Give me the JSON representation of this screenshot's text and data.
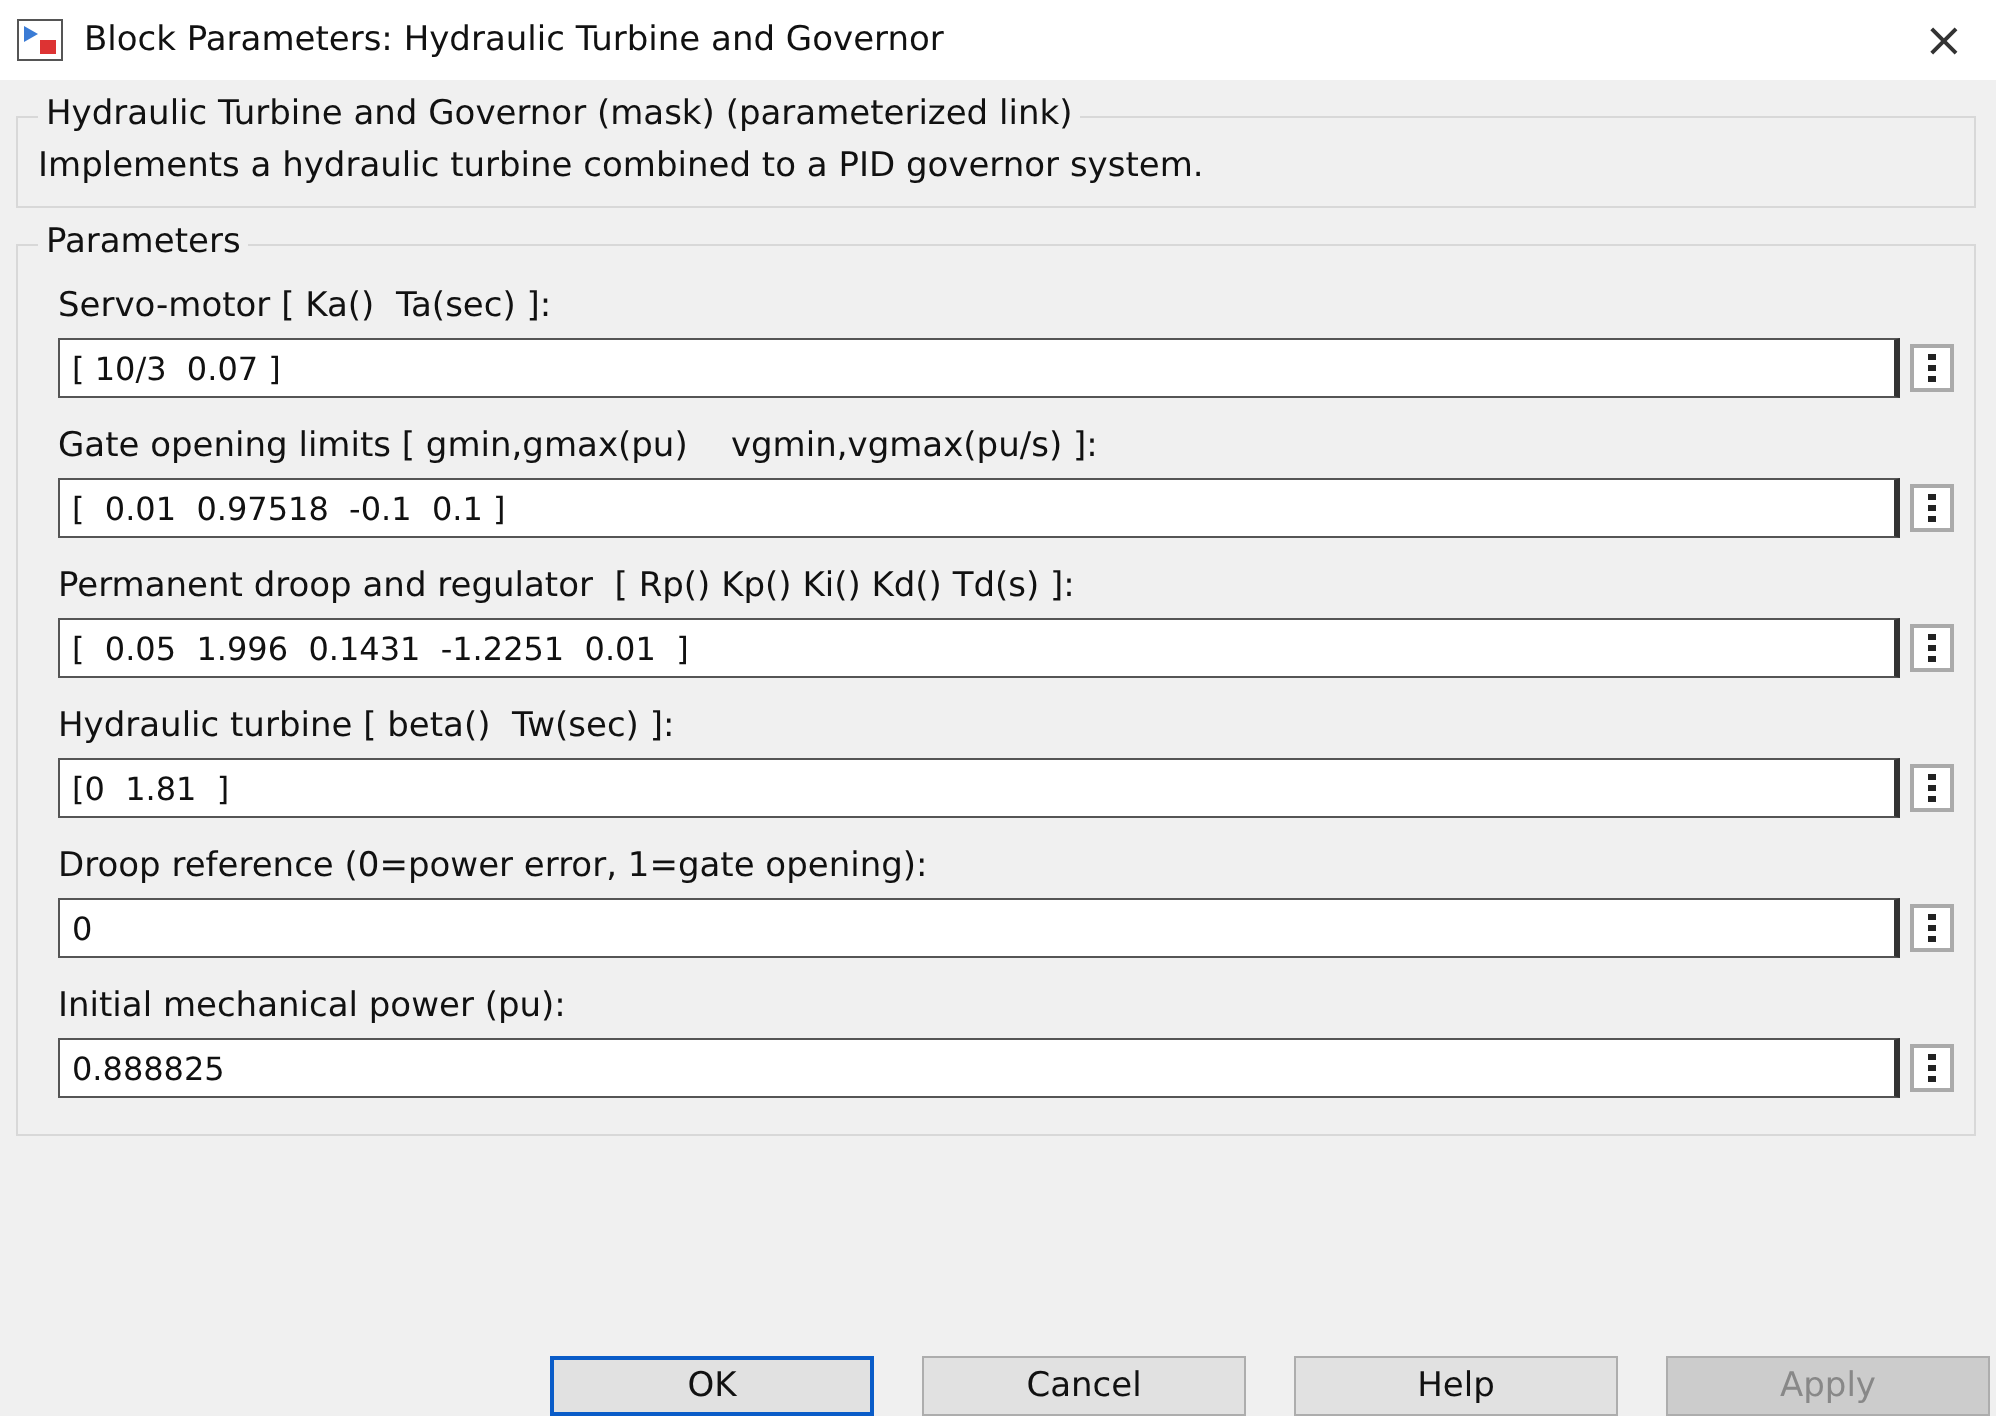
{
  "window": {
    "title": "Block Parameters: Hydraulic Turbine and Governor",
    "close": "×"
  },
  "description_group": {
    "title": "Hydraulic Turbine and Governor (mask) (parameterized link)",
    "text": "Implements a hydraulic turbine combined to a PID governor system."
  },
  "parameters_group": {
    "title": "Parameters",
    "params": [
      {
        "label": "Servo-motor [ Ka()  Ta(sec) ]:",
        "value": "[ 10/3  0.07 ]"
      },
      {
        "label": "Gate opening limits [ gmin,gmax(pu)    vgmin,vgmax(pu/s) ]:",
        "value": "[  0.01  0.97518  -0.1  0.1 ]"
      },
      {
        "label": "Permanent droop and regulator  [ Rp() Kp() Ki() Kd() Td(s) ]:",
        "value": "[  0.05  1.996  0.1431  -1.2251  0.01  ]"
      },
      {
        "label": "Hydraulic turbine [ beta()  Tw(sec) ]:",
        "value": "[0  1.81  ]"
      },
      {
        "label": "Droop reference (0=power error, 1=gate opening):",
        "value": "0"
      },
      {
        "label": "Initial mechanical power (pu):",
        "value": "0.888825"
      }
    ]
  },
  "buttons": [
    {
      "label": "OK",
      "default": true,
      "disabled": false
    },
    {
      "label": "Cancel",
      "default": false,
      "disabled": false
    },
    {
      "label": "Help",
      "default": false,
      "disabled": false
    },
    {
      "label": "Apply",
      "default": false,
      "disabled": true
    }
  ]
}
